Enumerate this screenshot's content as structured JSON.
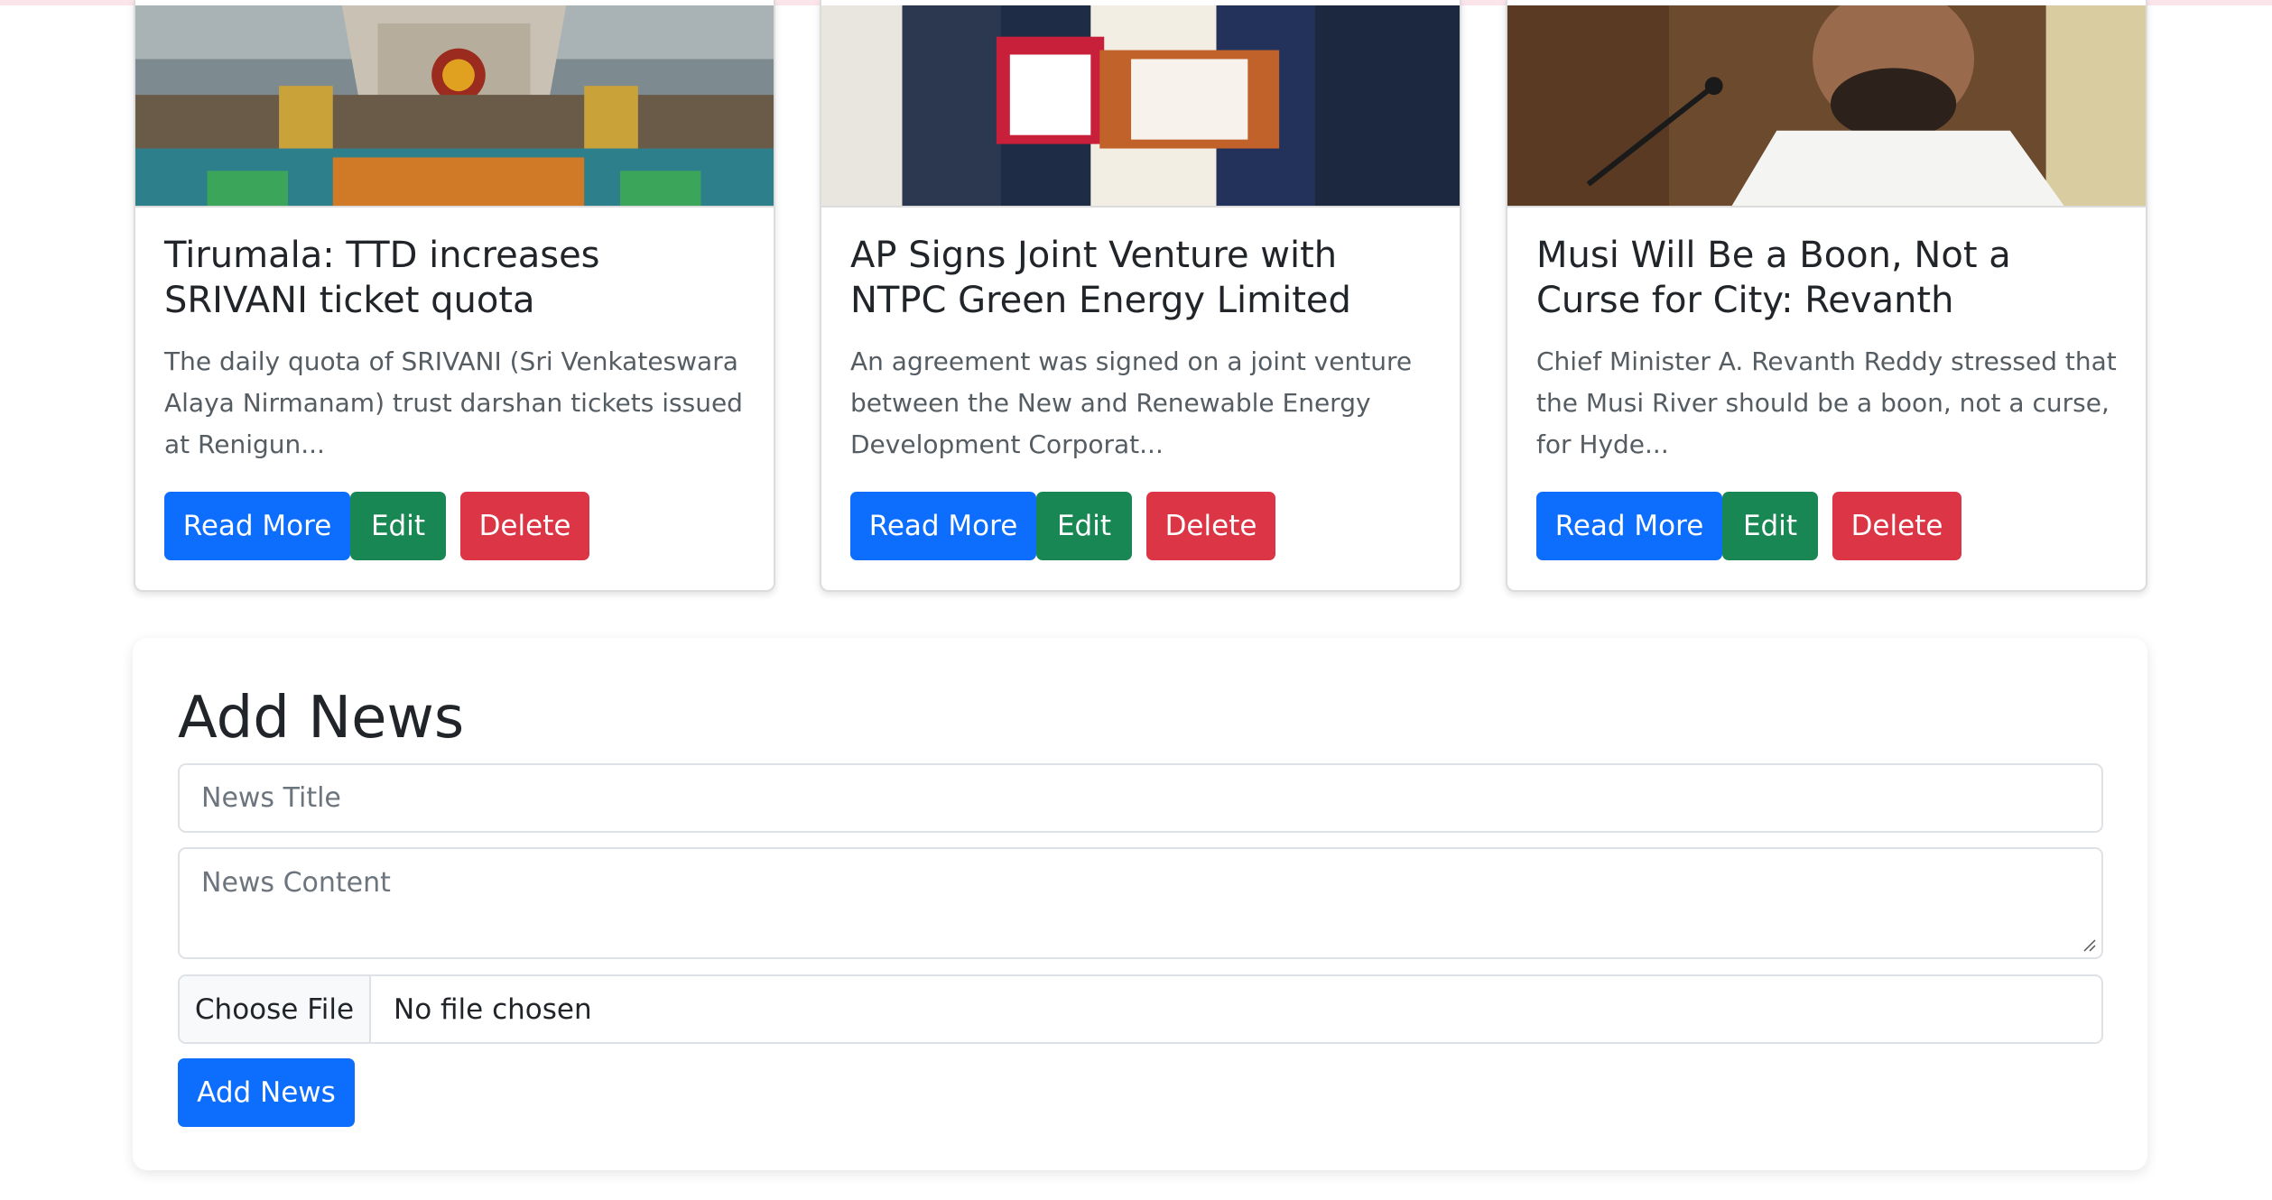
{
  "cards": [
    {
      "title": "Tirumala: TTD increases SRIVANI ticket quota",
      "excerpt": "The daily quota of SRIVANI (Sri Venkateswara Alaya Nirmanam) trust darshan tickets issued at Renigun...",
      "read_more": "Read More",
      "edit": "Edit",
      "delete": "Delete"
    },
    {
      "title": "AP Signs Joint Venture with NTPC Green Energy Limited",
      "excerpt": "An agreement was signed on a joint venture between the New and Renewable Energy Development Corporat...",
      "read_more": "Read More",
      "edit": "Edit",
      "delete": "Delete"
    },
    {
      "title": "Musi Will Be a Boon, Not a Curse for City: Revanth",
      "excerpt": "Chief Minister A. Revanth Reddy stressed that the Musi River should be a boon, not a curse, for Hyde...",
      "read_more": "Read More",
      "edit": "Edit",
      "delete": "Delete"
    }
  ],
  "add_news": {
    "heading": "Add News",
    "title_placeholder": "News Title",
    "content_placeholder": "News Content",
    "file_button": "Choose File",
    "file_status": "No file chosen",
    "submit": "Add News"
  },
  "colors": {
    "primary": "#0d6efd",
    "success": "#198754",
    "danger": "#dc3545"
  }
}
